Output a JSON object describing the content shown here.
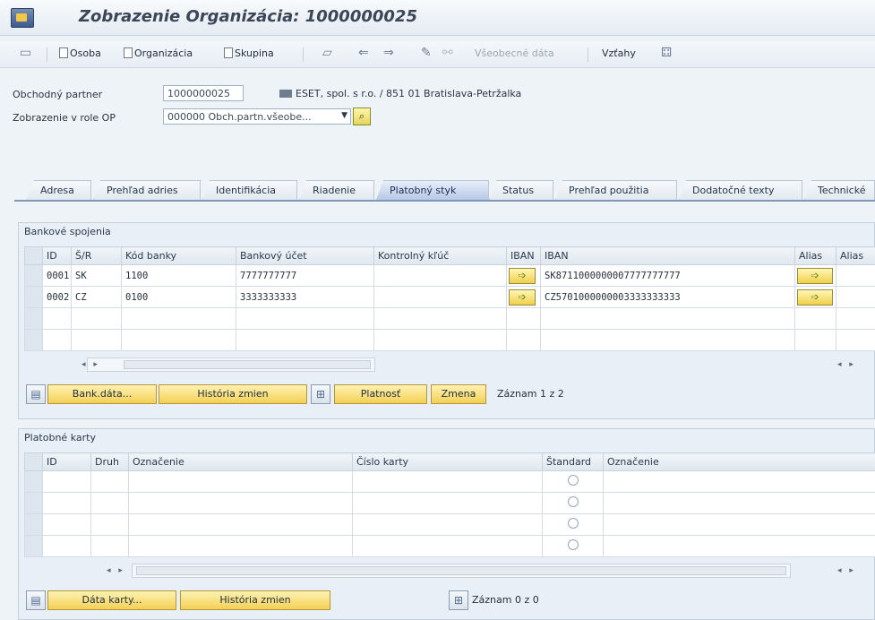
{
  "window": {
    "title": "Zobrazenie Organizácia: 1000000025"
  },
  "toolbar": {
    "items": {
      "osoba": "Osoba",
      "organizacia": "Organizácia",
      "skupina": "Skupina",
      "vseobecne_data": "Všeobecné dáta",
      "vztahy": "Vzťahy"
    }
  },
  "header": {
    "partner_label": "Obchodný partner",
    "partner_value": "1000000025",
    "partner_description": "ESET, spol. s r.o. / 851 01 Bratislava-Petržalka",
    "role_label": "Zobrazenie v role OP",
    "role_value": "000000 Obch.partn.všeobe..."
  },
  "tabs": {
    "adresa": "Adresa",
    "prehlad_adries": "Prehľad adries",
    "identifikacia": "Identifikácia",
    "riadenie": "Riadenie",
    "platobny_styk": "Platobný styk",
    "status": "Status",
    "prehlad_pouzitia": "Prehľad použitia",
    "dodatocne_texty": "Dodatočné texty",
    "technicke": "Technické"
  },
  "bank": {
    "title": "Bankové spojenia",
    "columns": {
      "id": "ID",
      "country": "Š/R",
      "bank_code": "Kód banky",
      "account": "Bankový účet",
      "check_key": "Kontrolný kľúč",
      "iban_btn": "IBAN",
      "iban": "IBAN",
      "alias_btn": "Alias",
      "alias": "Alias"
    },
    "rows": [
      {
        "id": "0001",
        "country": "SK",
        "bank_code": "1100",
        "account": "7777777777",
        "check_key": "",
        "iban": "SK8711000000007777777777"
      },
      {
        "id": "0002",
        "country": "CZ",
        "bank_code": "0100",
        "account": "3333333333",
        "check_key": "",
        "iban": "CZ5701000000003333333333"
      }
    ],
    "buttons": {
      "bank_data": "Bank.dáta...",
      "history": "História zmien",
      "validity": "Platnosť",
      "change": "Zmena"
    },
    "record_info": "Záznam 1 z 2"
  },
  "cards": {
    "title": "Platobné karty",
    "columns": {
      "id": "ID",
      "type": "Druh",
      "label": "Označenie",
      "number": "Číslo karty",
      "standard": "Štandard",
      "label2": "Označenie"
    },
    "buttons": {
      "card_data": "Dáta karty...",
      "history": "História zmien"
    },
    "record_info": "Záznam 0 z 0"
  },
  "colors": {
    "accent": "#7e97bd",
    "button_yellow": "#f3cf55",
    "background": "#eef3f8"
  }
}
